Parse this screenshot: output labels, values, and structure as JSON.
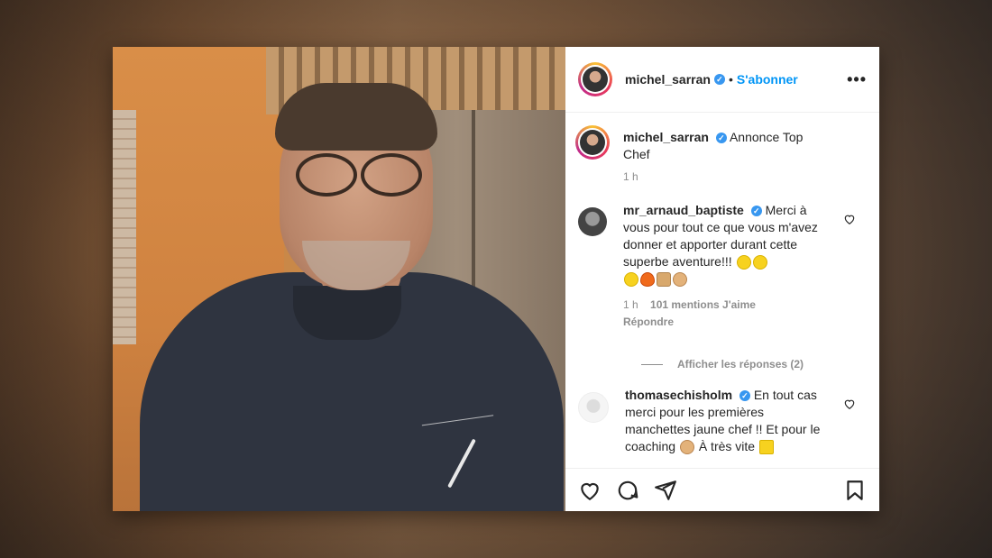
{
  "post": {
    "username": "michel_sarran",
    "follow_label": "S'abonner",
    "more_label": "•••",
    "caption_text": "Annonce Top Chef",
    "caption_time": "1 h"
  },
  "comments": [
    {
      "username": "mr_arnaud_baptiste",
      "text_before": "Merci à vous pour tout ce que vous m'avez donner et apporter durant cette superbe aventure!!!",
      "time": "1 h",
      "likes": "101 mentions J'aime",
      "reply_label": "Répondre",
      "view_replies": "Afficher les réponses (2)"
    },
    {
      "username": "thomasechisholm",
      "text_before": "En tout cas merci pour les premières manchettes jaune chef !! Et pour le coaching",
      "text_after": "À très vite"
    }
  ],
  "icons": {
    "verified": "verified-badge-icon",
    "like": "heart-icon",
    "comment": "comment-bubble-icon",
    "share": "paper-plane-icon",
    "save": "bookmark-icon"
  },
  "colors": {
    "accent": "#0095f6",
    "verified": "#3897f0",
    "text": "#262626",
    "muted": "#8e8e8e"
  }
}
